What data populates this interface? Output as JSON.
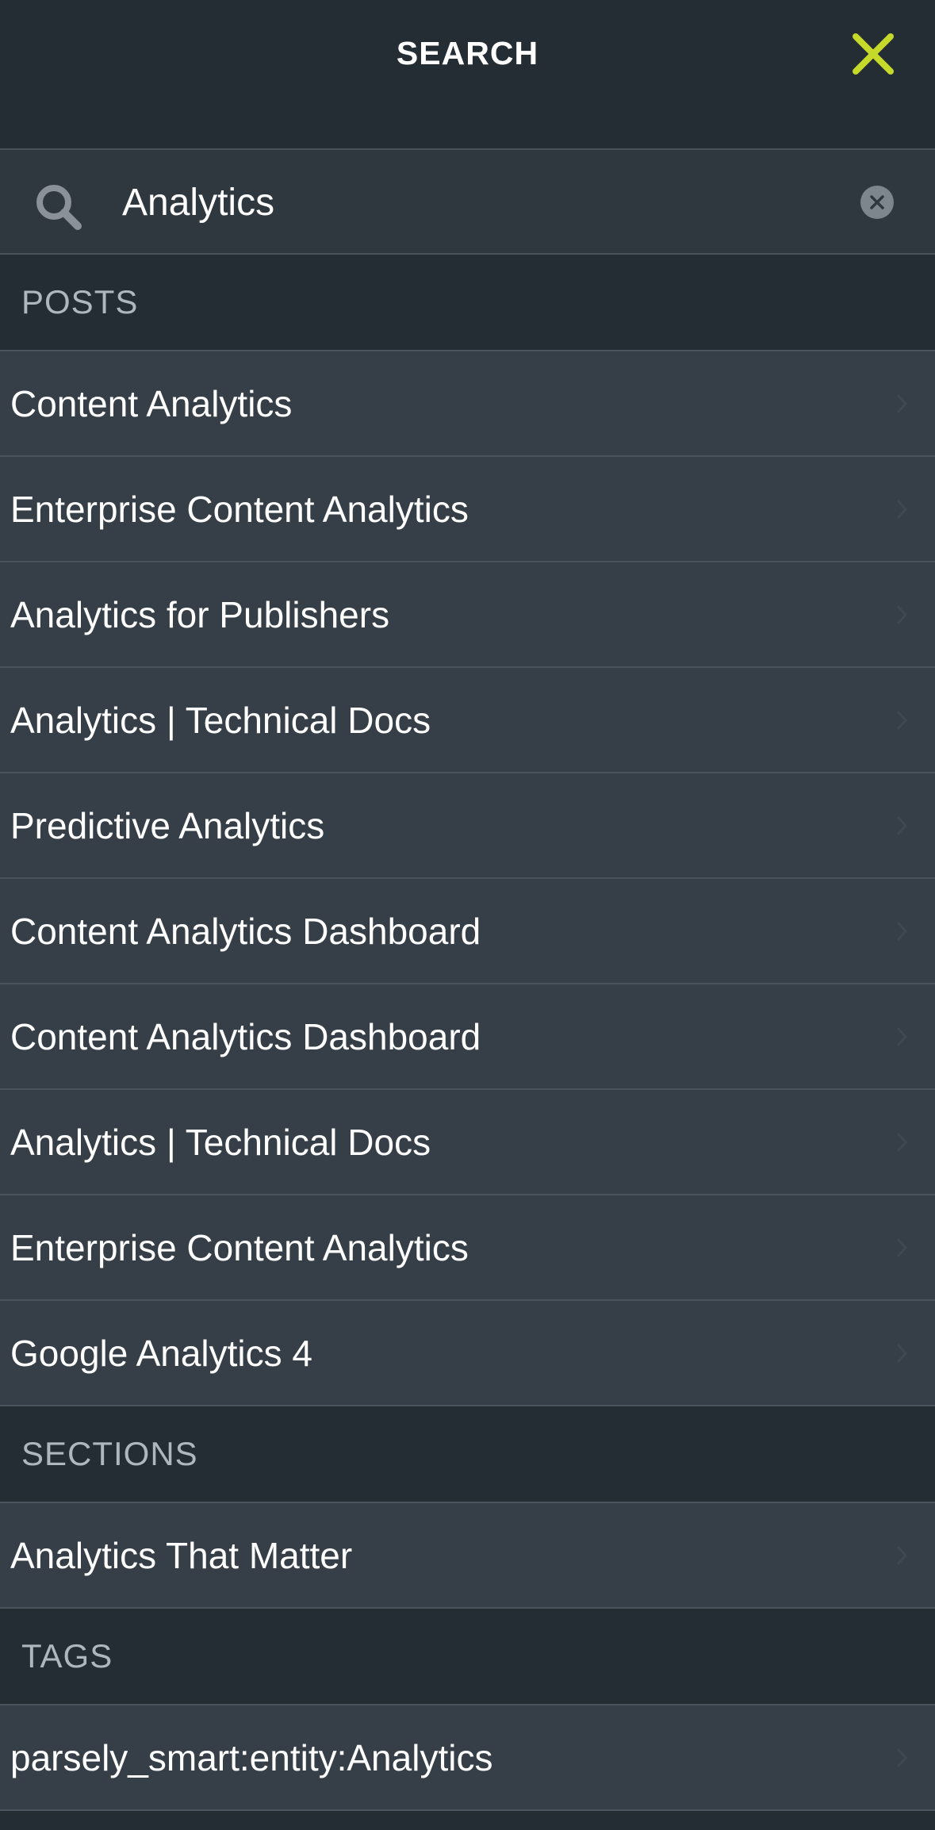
{
  "header": {
    "title": "SEARCH",
    "close_icon": "close-icon",
    "accent_color": "#c5d92b"
  },
  "search": {
    "value": "Analytics",
    "placeholder": "",
    "search_icon": "search-icon",
    "clear_icon": "clear-icon"
  },
  "posts": {
    "heading": "POSTS",
    "items": [
      {
        "label": "Content Analytics"
      },
      {
        "label": "Enterprise Content Analytics"
      },
      {
        "label": "Analytics for Publishers"
      },
      {
        "label": "Analytics | Technical Docs"
      },
      {
        "label": "Predictive Analytics"
      },
      {
        "label": "Content Analytics Dashboard"
      },
      {
        "label": "Content Analytics Dashboard"
      },
      {
        "label": "Analytics | Technical Docs"
      },
      {
        "label": "Enterprise Content Analytics"
      },
      {
        "label": "Google Analytics 4"
      }
    ]
  },
  "sections": {
    "heading": "SECTIONS",
    "items": [
      {
        "label": "Analytics That Matter"
      }
    ]
  },
  "tags": {
    "heading": "TAGS",
    "items": [
      {
        "label": "parsely_smart:entity:Analytics"
      }
    ]
  }
}
